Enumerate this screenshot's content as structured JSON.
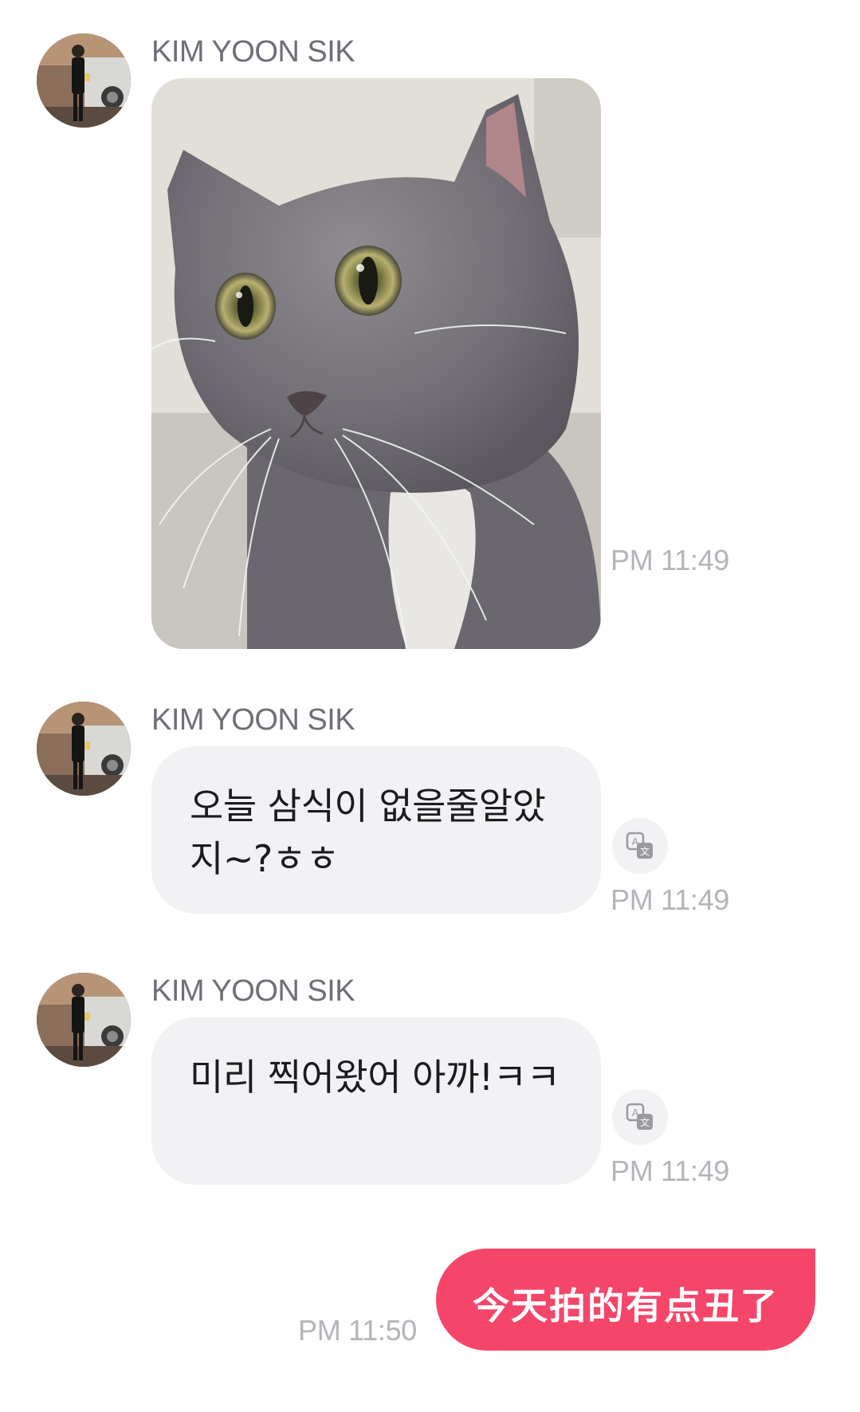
{
  "messages": [
    {
      "sender": "KIM YOON SIK",
      "type": "image",
      "image_subject": "gray cat close-up",
      "time": "PM 11:49"
    },
    {
      "sender": "KIM YOON SIK",
      "type": "text",
      "text": "오늘 삼식이 없을줄알았지~?ㅎㅎ",
      "translate_icon": "translate-icon",
      "time": "PM 11:49"
    },
    {
      "sender": "KIM YOON SIK",
      "type": "text",
      "text": "미리 찍어왔어 아까!ㅋㅋ",
      "translate_icon": "translate-icon",
      "time": "PM 11:49"
    }
  ],
  "outgoing": {
    "text": "今天拍的有点丑了",
    "time": "PM 11:50"
  },
  "colors": {
    "outgoing_bubble": "#f5466a",
    "incoming_bubble": "#f2f2f4",
    "timestamp": "#b4b4ba",
    "sender_name": "#6e6e76"
  }
}
